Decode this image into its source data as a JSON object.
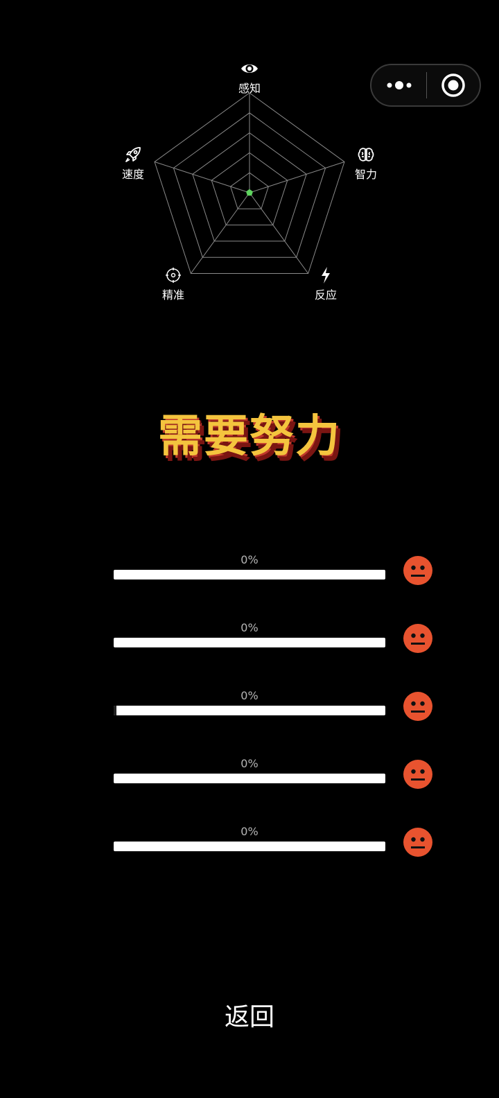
{
  "capsule": {
    "more_icon": "more-dots-icon",
    "close_icon": "target-circle-icon"
  },
  "radar": {
    "levels": 5,
    "max": 100,
    "grid_color": "#8a8a8a",
    "point_color": "#5fd35f",
    "axes": [
      {
        "label": "感知",
        "icon": "eye-icon",
        "value": 0
      },
      {
        "label": "智力",
        "icon": "brain-icon",
        "value": 0
      },
      {
        "label": "反应",
        "icon": "lightning-icon",
        "value": 0
      },
      {
        "label": "精准",
        "icon": "crosshair-icon",
        "value": 0
      },
      {
        "label": "速度",
        "icon": "rocket-icon",
        "value": 0
      }
    ]
  },
  "verdict": {
    "text": "需要努力",
    "color": "#f4c43e"
  },
  "scores": [
    {
      "percent_label": "0%",
      "fraction": 0,
      "face": "neutral-face-icon"
    },
    {
      "percent_label": "0%",
      "fraction": 0,
      "face": "neutral-face-icon"
    },
    {
      "percent_label": "0%",
      "fraction": 0.01,
      "face": "neutral-face-icon"
    },
    {
      "percent_label": "0%",
      "fraction": 0,
      "face": "neutral-face-icon"
    },
    {
      "percent_label": "0%",
      "fraction": 0,
      "face": "neutral-face-icon"
    }
  ],
  "face_color": "#e8532f",
  "back_label": "返回"
}
